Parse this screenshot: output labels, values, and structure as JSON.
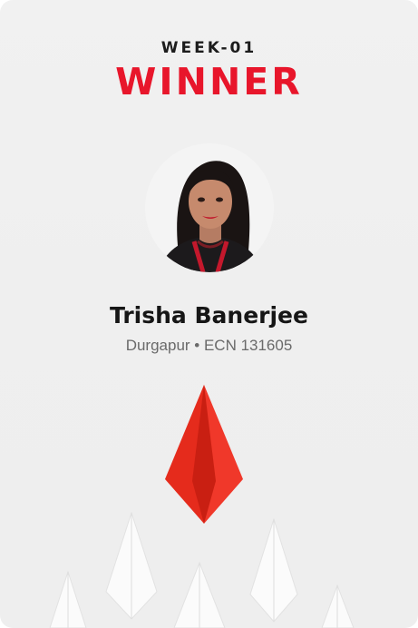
{
  "card": {
    "kicker": "WEEK-01",
    "title": "WINNER",
    "name": "Trisha Banerjee",
    "meta": "Durgapur • ECN 131605"
  },
  "colors": {
    "accent": "#e8162b",
    "name_text": "#161616",
    "meta_text": "#6a6a6a",
    "background": "#efefef"
  },
  "icons": {
    "avatar": "person-photo",
    "lead_plane": "red-paper-airplane-icon",
    "other_planes": "white-paper-airplane-icon"
  }
}
